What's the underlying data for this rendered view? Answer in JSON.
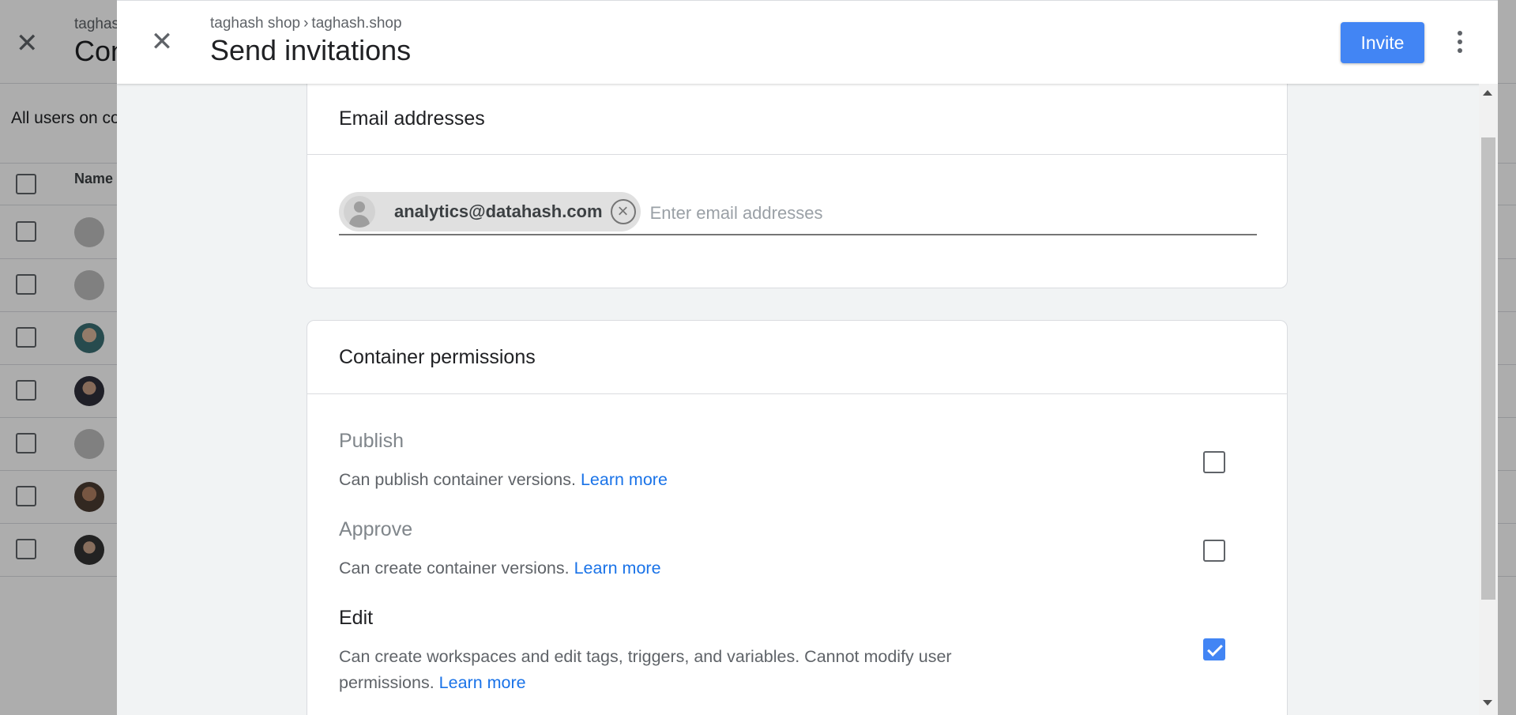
{
  "background": {
    "breadcrumb": "taghash shop",
    "title": "Container Users",
    "subtitle": "All users on container",
    "name_column": "Name",
    "rows": [
      {
        "avatar": "default-avatar"
      },
      {
        "avatar": "default-avatar"
      },
      {
        "avatar": "photo"
      },
      {
        "avatar": "photo"
      },
      {
        "avatar": "default-avatar"
      },
      {
        "avatar": "photo"
      },
      {
        "avatar": "photo"
      }
    ]
  },
  "dialog": {
    "breadcrumb": {
      "account": "taghash shop",
      "separator": "›",
      "container": "taghash.shop"
    },
    "title": "Send invitations",
    "invite_label": "Invite",
    "close_icon": "close-icon",
    "more_icon": "more-vert-icon"
  },
  "email_card": {
    "title": "Email addresses",
    "chips": [
      {
        "email": "analytics@datahash.com"
      }
    ],
    "input_placeholder": "Enter email addresses",
    "input_value": ""
  },
  "permissions_card": {
    "title": "Container permissions",
    "items": [
      {
        "name": "Publish",
        "description": "Can publish container versions.",
        "learn_more": "Learn more",
        "checked": false
      },
      {
        "name": "Approve",
        "description": "Can create container versions.",
        "learn_more": "Learn more",
        "checked": false
      },
      {
        "name": "Edit",
        "description": "Can create workspaces and edit tags, triggers, and variables. Cannot modify user permissions.",
        "learn_more": "Learn more",
        "checked": true
      }
    ]
  },
  "colors": {
    "accent": "#4285f4",
    "link": "#1a73e8",
    "dialog_background": "#f1f3f4"
  }
}
